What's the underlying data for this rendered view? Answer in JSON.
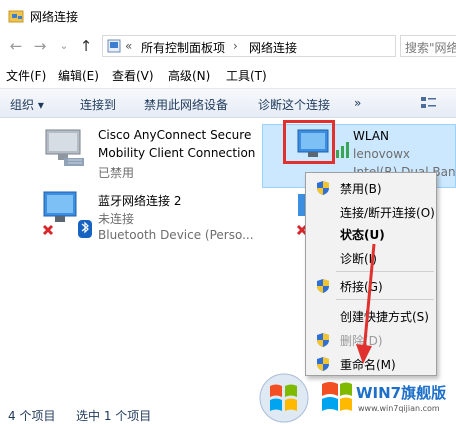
{
  "window": {
    "title": "网络连接"
  },
  "address": {
    "back_icon": "back-arrow-icon",
    "forward_icon": "forward-arrow-icon",
    "dropdown_icon": "chevron-down-icon",
    "up_icon": "up-arrow-icon",
    "overflow": "«",
    "crumb1": "所有控制面板项",
    "separator": "›",
    "crumb2": "网络连接",
    "search_placeholder": "搜索\"网络"
  },
  "menu": [
    {
      "label": "文件(F)"
    },
    {
      "label": "编辑(E)"
    },
    {
      "label": "查看(V)"
    },
    {
      "label": "高级(N)"
    },
    {
      "label": "工具(T)"
    }
  ],
  "commands": {
    "organize": "组织 ▾",
    "connect": "连接到",
    "disable": "禁用此网络设备",
    "diagnose": "诊断这个连接",
    "more": "»",
    "view_icon": "view-options-icon"
  },
  "connections": [
    {
      "name_line1": "Cisco AnyConnect Secure",
      "name_line2": "Mobility Client Connection",
      "status": "已禁用"
    },
    {
      "name": "WLAN",
      "sub1": "lenovowx",
      "sub2": "Intel(R) Dual Band"
    },
    {
      "name": "蓝牙网络连接 2",
      "status": "未连接",
      "device": "Bluetooth Device (Perso..."
    }
  ],
  "context_menu": {
    "items": [
      {
        "label": "禁用(B)"
      },
      {
        "label": "连接/断开连接(O)"
      },
      {
        "label": "状态(U)"
      },
      {
        "label": "诊断(I)"
      },
      {
        "label": "桥接(G)"
      },
      {
        "label": "创建快捷方式(S)"
      },
      {
        "label": "删除(D)"
      },
      {
        "label": "重命名(M)"
      }
    ]
  },
  "status": {
    "items_count": "4 个项目",
    "selected_count": "选中 1 个项目"
  },
  "watermark": {
    "text": "WIN7旗舰版",
    "url": "www.win7qijian.com"
  },
  "colors": {
    "selection": "#cce8ff",
    "highlight_red": "#e0312f",
    "accent_blue": "#1d6fc9"
  }
}
